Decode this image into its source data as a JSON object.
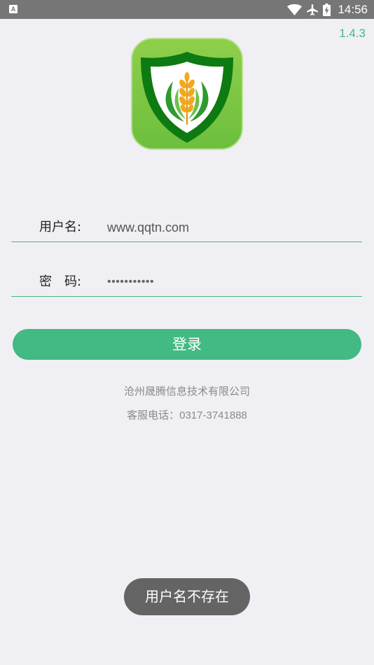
{
  "status_bar": {
    "notification_icon": "a-notification-icon",
    "icons": [
      "wifi-icon",
      "airplane-mode-icon",
      "battery-charging-icon"
    ],
    "time": "14:56"
  },
  "app": {
    "version": "1.4.3",
    "logo_icon": "wheat-shield-logo"
  },
  "form": {
    "username_label": "用户名:",
    "username_value": "www.qqtn.com",
    "password_label": "密 码:",
    "password_value": "•••••••••••",
    "login_button": "登录"
  },
  "footer": {
    "company": "沧州晟腾信息技术有限公司",
    "phone_label": "客服电话：",
    "phone_number": "0317-3741888"
  },
  "toast": {
    "message": "用户名不存在"
  },
  "colors": {
    "accent": "#43b983",
    "status_bar": "#767676",
    "background": "#f0eff4",
    "toast": "#646464"
  }
}
